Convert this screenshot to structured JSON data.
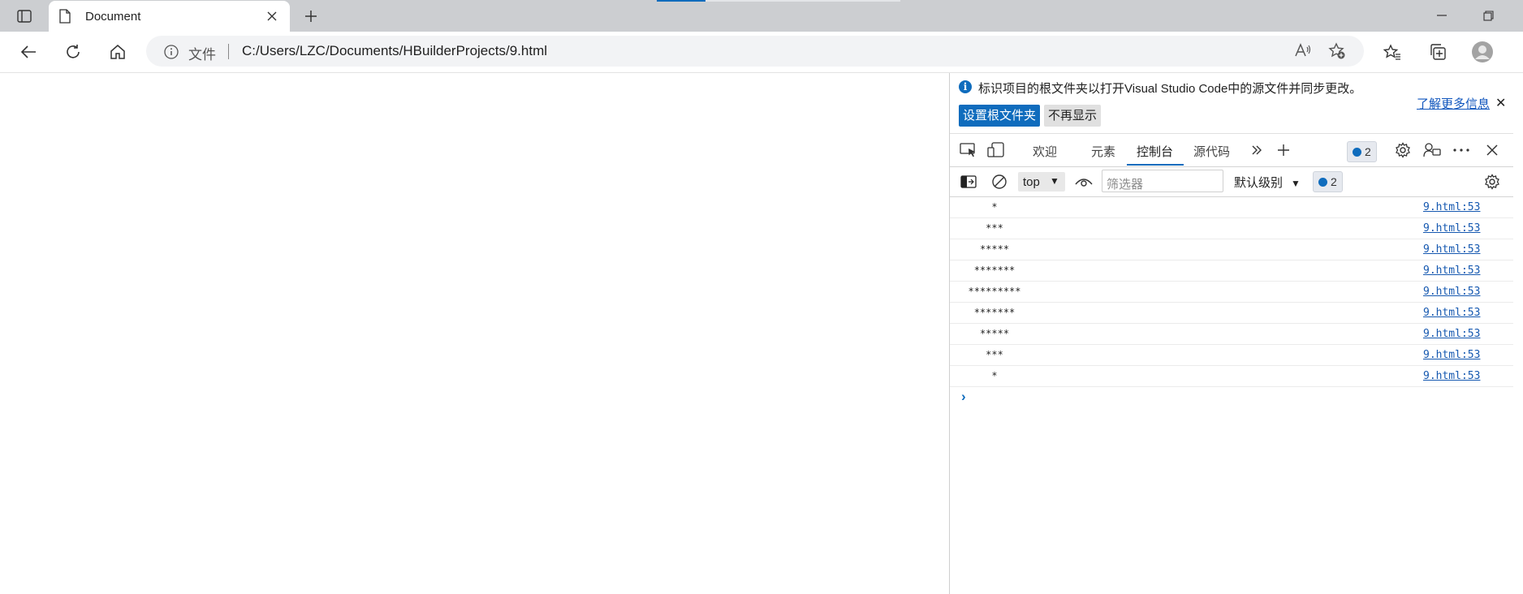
{
  "browser": {
    "tab": {
      "title": "Document"
    },
    "address": {
      "scheme_label": "文件",
      "url": "C:/Users/LZC/Documents/HBuilderProjects/9.html"
    }
  },
  "devtools": {
    "notice": {
      "message": "标识项目的根文件夹以打开Visual Studio Code中的源文件并同步更改。",
      "learn_more": "了解更多信息",
      "close": "✕",
      "set_root_button": "设置根文件夹",
      "dont_show_button": "不再显示"
    },
    "tabs": [
      {
        "label": "欢迎"
      },
      {
        "label": "元素"
      },
      {
        "label": "控制台"
      },
      {
        "label": "源代码"
      }
    ],
    "issues_count": "2",
    "console": {
      "context": "top",
      "filter_placeholder": "筛选器",
      "level": "默认级别",
      "issues_count": "2",
      "messages": [
        {
          "text": "*",
          "source": "9.html:53"
        },
        {
          "text": "***",
          "source": "9.html:53"
        },
        {
          "text": "*****",
          "source": "9.html:53"
        },
        {
          "text": "*******",
          "source": "9.html:53"
        },
        {
          "text": "*********",
          "source": "9.html:53"
        },
        {
          "text": "*******",
          "source": "9.html:53"
        },
        {
          "text": "*****",
          "source": "9.html:53"
        },
        {
          "text": "***",
          "source": "9.html:53"
        },
        {
          "text": "*",
          "source": "9.html:53"
        }
      ]
    }
  },
  "colors": {
    "accent": "#0f6cbd",
    "link": "#1558b0",
    "tabstrip": "#ccced1"
  }
}
